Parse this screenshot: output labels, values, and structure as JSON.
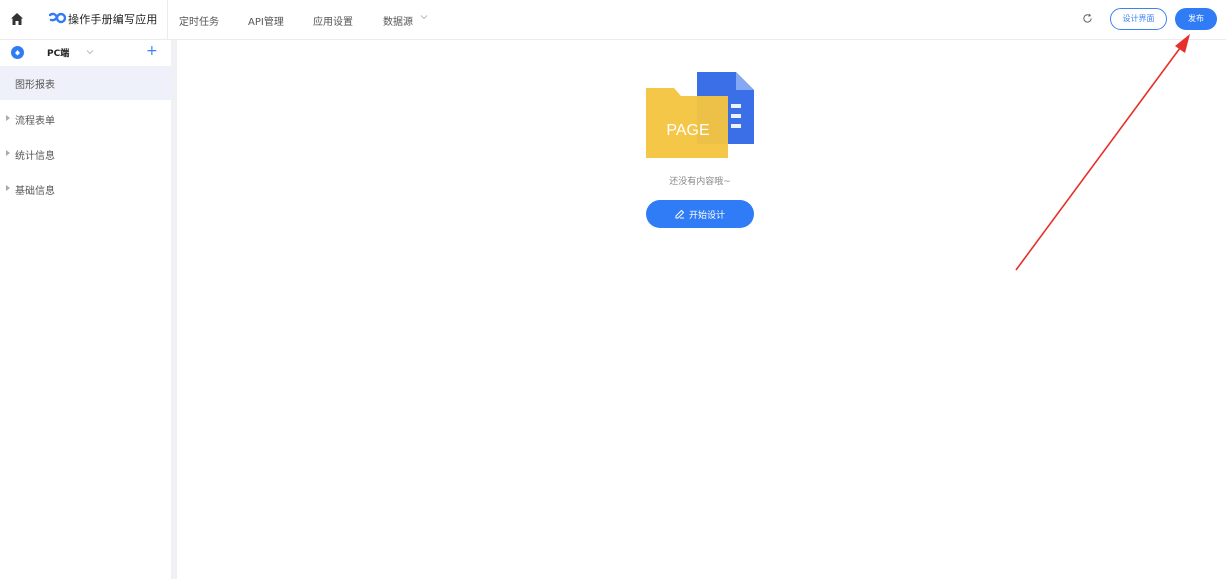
{
  "header": {
    "app_title": "操作手册编写应用",
    "nav": [
      {
        "label": "定时任务"
      },
      {
        "label": "API管理"
      },
      {
        "label": "应用设置"
      },
      {
        "label": "数据源"
      }
    ],
    "design_button": "设计界面",
    "publish_button": "发布"
  },
  "sidebar": {
    "platform_label": "PC端",
    "add_label": "+",
    "items": [
      {
        "label": "图形报表",
        "active": true
      },
      {
        "label": "流程表单",
        "active": false
      },
      {
        "label": "统计信息",
        "active": false
      },
      {
        "label": "基础信息",
        "active": false
      }
    ]
  },
  "main": {
    "illustration_text": "PAGE",
    "empty_text": "还没有内容哦~",
    "start_button": "开始设计"
  },
  "colors": {
    "primary": "#2f7cf6",
    "folder": "#f5c542",
    "doc": "#3b6fe8",
    "annotation_arrow": "#e8302a"
  },
  "icons": [
    "home-icon",
    "app-logo-icon",
    "chevron-down-icon",
    "refresh-icon",
    "platform-icon",
    "plus-icon",
    "caret-right-icon",
    "page-illustration",
    "edit-icon"
  ]
}
